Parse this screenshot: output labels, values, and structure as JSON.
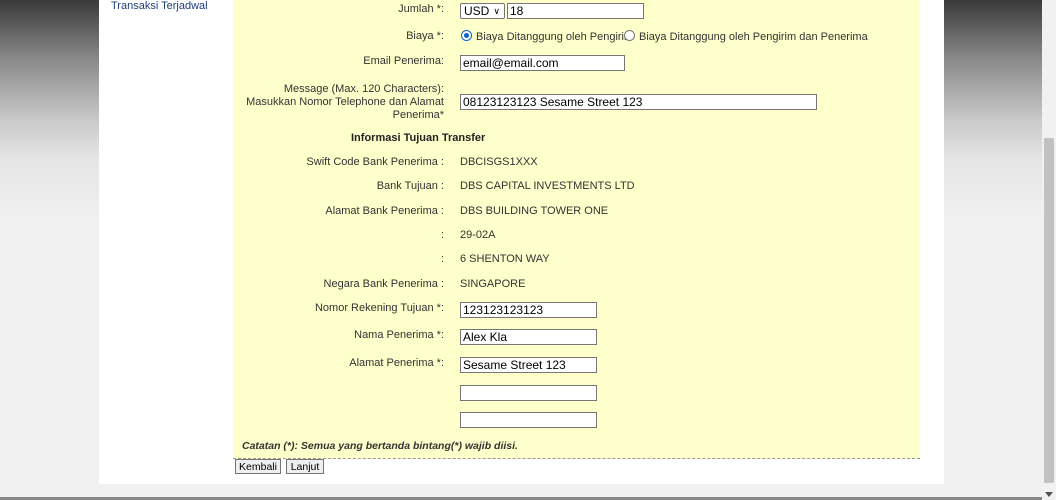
{
  "sidebar": {
    "link_label": "Transaksi Terjadwal"
  },
  "form": {
    "jumlah": {
      "label": "Jumlah *:",
      "currency": "USD",
      "amount": "18"
    },
    "biaya": {
      "label": "Biaya *:",
      "options": [
        {
          "label": "Biaya Ditanggung oleh Pengirim",
          "checked": true
        },
        {
          "label": "Biaya Ditanggung oleh Pengirim dan Penerima",
          "checked": false
        }
      ]
    },
    "email": {
      "label": "Email Penerima:",
      "value": "email@email.com"
    },
    "message": {
      "label_line1": "Message (Max. 120 Characters):",
      "label_line2": "Masukkan Nomor Telephone dan Alamat",
      "label_line3": "Penerima*",
      "value": "08123123123 Sesame Street 123"
    },
    "section_title": "Informasi Tujuan Transfer",
    "swift": {
      "label": "Swift Code Bank Penerima :",
      "value": "DBCISGS1XXX"
    },
    "bank": {
      "label": "Bank Tujuan :",
      "value": "DBS CAPITAL INVESTMENTS LTD"
    },
    "alamat_bank": {
      "label": "Alamat Bank Penerima :",
      "lines": [
        "DBS BUILDING TOWER ONE",
        "29-02A",
        "6 SHENTON WAY"
      ],
      "continuation_label": ":"
    },
    "negara": {
      "label": "Negara Bank Penerima :",
      "value": "SINGAPORE"
    },
    "rekening": {
      "label": "Nomor Rekening Tujuan *:",
      "value": "123123123123"
    },
    "nama": {
      "label": "Nama Penerima *:",
      "value": "Alex Kla"
    },
    "alamat_penerima": {
      "label": "Alamat Penerima *:",
      "value": "Sesame Street 123",
      "extra_values": [
        "",
        ""
      ]
    },
    "note": "Catatan (*): Semua yang bertanda bintang(*) wajib diisi."
  },
  "buttons": {
    "back": "Kembali",
    "next": "Lanjut"
  },
  "colors": {
    "panel": "#ffffcc",
    "link": "#1f3f7a",
    "radio_accent": "#0a63c9"
  },
  "icons": {
    "select_chevron": "chevron-down-icon",
    "scroll_arrow": "arrow-down-icon"
  }
}
